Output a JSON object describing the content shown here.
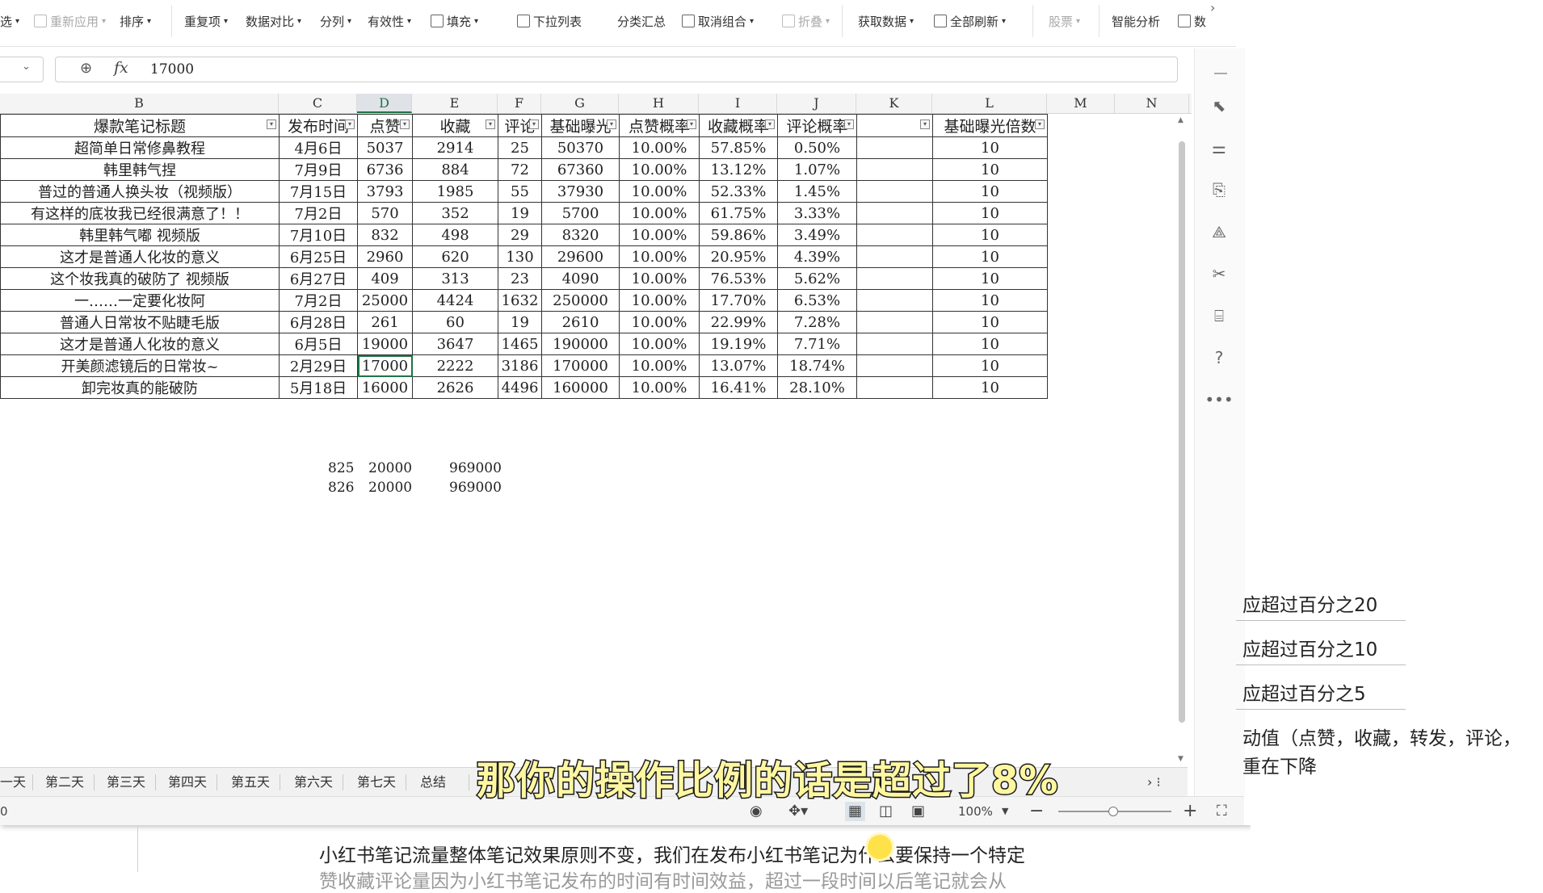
{
  "ribbon": {
    "items": [
      {
        "label": "选",
        "disabled": false
      },
      {
        "label": "重新应用",
        "disabled": true
      },
      {
        "label": "排序",
        "disabled": false
      },
      {
        "label": "重复项",
        "disabled": false
      },
      {
        "label": "数据对比",
        "disabled": false
      },
      {
        "label": "分列",
        "disabled": false
      },
      {
        "label": "有效性",
        "disabled": false
      },
      {
        "label": "填充",
        "disabled": false
      },
      {
        "label": "下拉列表",
        "disabled": false
      },
      {
        "label": "分类汇总",
        "disabled": false
      },
      {
        "label": "取消组合",
        "disabled": false
      },
      {
        "label": "折叠",
        "disabled": true
      },
      {
        "label": "获取数据",
        "disabled": false
      },
      {
        "label": "全部刷新",
        "disabled": false
      },
      {
        "label": "股票",
        "disabled": true
      },
      {
        "label": "智能分析",
        "disabled": false
      },
      {
        "label": "数",
        "disabled": false
      }
    ]
  },
  "formula": {
    "fx_label": "fx",
    "value": "17000"
  },
  "columns": [
    "B",
    "C",
    "D",
    "E",
    "F",
    "G",
    "H",
    "I",
    "J",
    "K",
    "L",
    "M",
    "N"
  ],
  "table": {
    "headers": [
      "爆款笔记标题",
      "发布时间",
      "点赞",
      "收藏",
      "评论",
      "基础曝光",
      "点赞概率",
      "收藏概率",
      "评论概率",
      "",
      "基础曝光倍数"
    ],
    "rows": [
      [
        "超简单日常修鼻教程",
        "4月6日",
        "5037",
        "2914",
        "25",
        "50370",
        "10.00%",
        "57.85%",
        "0.50%",
        "",
        "10"
      ],
      [
        "韩里韩气捏",
        "7月9日",
        "6736",
        "884",
        "72",
        "67360",
        "10.00%",
        "13.12%",
        "1.07%",
        "",
        "10"
      ],
      [
        "普过的普通人换头妆（视频版）",
        "7月15日",
        "3793",
        "1985",
        "55",
        "37930",
        "10.00%",
        "52.33%",
        "1.45%",
        "",
        "10"
      ],
      [
        "有这样的底妆我已经很满意了！！",
        "7月2日",
        "570",
        "352",
        "19",
        "5700",
        "10.00%",
        "61.75%",
        "3.33%",
        "",
        "10"
      ],
      [
        "韩里韩气嘟 视频版",
        "7月10日",
        "832",
        "498",
        "29",
        "8320",
        "10.00%",
        "59.86%",
        "3.49%",
        "",
        "10"
      ],
      [
        "这才是普通人化妆的意义",
        "6月25日",
        "2960",
        "620",
        "130",
        "29600",
        "10.00%",
        "20.95%",
        "4.39%",
        "",
        "10"
      ],
      [
        "这个妆我真的破防了 视频版",
        "6月27日",
        "409",
        "313",
        "23",
        "4090",
        "10.00%",
        "76.53%",
        "5.62%",
        "",
        "10"
      ],
      [
        "一……一定要化妆阿",
        "7月2日",
        "25000",
        "4424",
        "1632",
        "250000",
        "10.00%",
        "17.70%",
        "6.53%",
        "",
        "10"
      ],
      [
        "普通人日常妆不贴睫毛版",
        "6月28日",
        "261",
        "60",
        "19",
        "2610",
        "10.00%",
        "22.99%",
        "7.28%",
        "",
        "10"
      ],
      [
        "这才是普通人化妆的意义",
        "6月5日",
        "19000",
        "3647",
        "1465",
        "190000",
        "10.00%",
        "19.19%",
        "7.71%",
        "",
        "10"
      ],
      [
        "开美颜滤镜后的日常妆~",
        "2月29日",
        "17000",
        "2222",
        "3186",
        "170000",
        "10.00%",
        "13.07%",
        "18.74%",
        "",
        "10"
      ],
      [
        "卸完妆真的能破防",
        "5月18日",
        "16000",
        "2626",
        "4496",
        "160000",
        "10.00%",
        "16.41%",
        "28.10%",
        "",
        "10"
      ]
    ],
    "active_cell": {
      "row": 10,
      "col": 2
    }
  },
  "stray_rows": [
    {
      "a": "825",
      "b": "20000",
      "c": "969000"
    },
    {
      "a": "826",
      "b": "20000",
      "c": "969000"
    }
  ],
  "sheet_tabs": [
    "一天",
    "第二天",
    "第三天",
    "第四天",
    "第五天",
    "第六天",
    "第七天",
    "总结"
  ],
  "status": {
    "left_text": "0",
    "zoom": "100%"
  },
  "doc_lines": [
    "应超过百分之20",
    "应超过百分之10",
    "应超过百分之5",
    "动值（点赞，收藏，转发，评论，",
    "重在下降"
  ],
  "bottom_doc": "小红书笔记流量整体笔记效果原则不变，我们在发布小红书笔记为什么要保持一个特定",
  "bottom_doc2": "赞收藏评论量因为小红书笔记发布的时间有时间效益，超过一段时间以后笔记就会从",
  "subtitle": "那你的操作比例的话是超过了8%"
}
